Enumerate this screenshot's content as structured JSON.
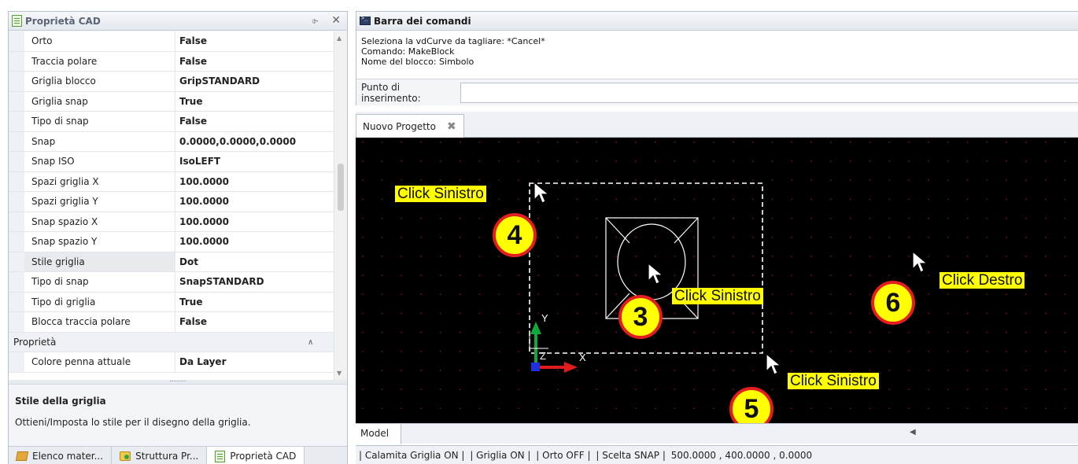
{
  "left_panel": {
    "title": "Proprietà CAD",
    "pin_glyph": "⌱",
    "close_glyph": "✕",
    "rows": [
      {
        "name": "Orto",
        "value": "False"
      },
      {
        "name": "Traccia polare",
        "value": "False"
      },
      {
        "name": "Griglia blocco",
        "value": "GripSTANDARD"
      },
      {
        "name": "Griglia snap",
        "value": "True"
      },
      {
        "name": "Tipo di snap",
        "value": "False"
      },
      {
        "name": "Snap",
        "value": "0.0000,0.0000,0.0000"
      },
      {
        "name": "Snap ISO",
        "value": "IsoLEFT"
      },
      {
        "name": "Spazi griglia X",
        "value": "100.0000"
      },
      {
        "name": "Spazi griglia Y",
        "value": "100.0000"
      },
      {
        "name": "Snap spazio X",
        "value": "100.0000"
      },
      {
        "name": "Snap spazio Y",
        "value": "100.0000"
      },
      {
        "name": "Stile griglia",
        "value": "Dot"
      },
      {
        "name": "Tipo di snap",
        "value": "SnapSTANDARD"
      },
      {
        "name": "Tipo di griglia",
        "value": "True"
      },
      {
        "name": "Blocca traccia polare",
        "value": "False"
      }
    ],
    "category": {
      "label": "Proprietà",
      "toggle_glyph": "∧"
    },
    "extra_row": {
      "name": "Colore penna attuale",
      "value": "Da Layer"
    },
    "description": {
      "title": "Stile della griglia",
      "text": "Ottieni/Imposta lo stile per il disegno della griglia."
    },
    "bottom_tabs": [
      {
        "label": "Elenco mater...",
        "icon": "book-icon"
      },
      {
        "label": "Struttura Pr...",
        "icon": "tree-icon"
      },
      {
        "label": "Proprietà CAD",
        "icon": "properties-icon"
      }
    ]
  },
  "command_bar": {
    "title": "Barra dei comandi",
    "history": [
      "Seleziona la vdCurve da tagliare: *Cancel*",
      "Comando: MakeBlock",
      "Nome del blocco: Simbolo"
    ],
    "input_label": "Punto di inserimento:",
    "input_value": ""
  },
  "document": {
    "tab_label": "Nuovo Progetto",
    "tab_close_glyph": "✖",
    "model_tab": "Model",
    "hscroll_left_glyph": "◀"
  },
  "canvas": {
    "background": "#000000",
    "grid_dot_color": "#8a1e1e",
    "axis_x_label": "X",
    "axis_y_label": "Y",
    "axis_z_label": "Z"
  },
  "annotations": {
    "callouts": [
      "Click Sinistro",
      "Click Sinistro",
      "Click Destro",
      "Click Sinistro"
    ],
    "badges": [
      "4",
      "3",
      "6",
      "5"
    ],
    "highlight_color": "#ffff00",
    "badge_border_color": "#e41e1e"
  },
  "status_bar": {
    "items": [
      "| Calamita Griglia ON |",
      "| Griglia ON |",
      "| Orto OFF |",
      "| Scelta SNAP |",
      "500.0000 , 400.0000 , 0.0000"
    ]
  }
}
